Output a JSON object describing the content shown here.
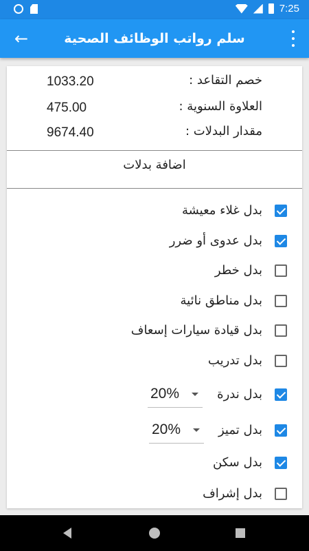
{
  "status_bar": {
    "time": "7:25"
  },
  "app_bar": {
    "title": "سلم رواتب الوظائف الصحية"
  },
  "summary": [
    {
      "label": "خصم التقاعد :",
      "value": "1033.20"
    },
    {
      "label": "العلاوة السنوية :",
      "value": "475.00"
    },
    {
      "label": "مقدار البدلات :",
      "value": "9674.40"
    }
  ],
  "allowances_section": {
    "title": "اضافة بدلات"
  },
  "allowances": [
    {
      "label": "بدل غلاء معيشة",
      "checked": true
    },
    {
      "label": "بدل عدوى أو ضرر",
      "checked": true
    },
    {
      "label": "بدل خطر",
      "checked": false
    },
    {
      "label": "بدل مناطق نائية",
      "checked": false
    },
    {
      "label": "بدل قيادة سيارات إسعاف",
      "checked": false
    },
    {
      "label": "بدل تدريب",
      "checked": false
    },
    {
      "label": "بدل ندرة",
      "checked": true,
      "dropdown": "20%"
    },
    {
      "label": "بدل تميز",
      "checked": true,
      "dropdown": "20%"
    },
    {
      "label": "بدل سكن",
      "checked": true
    },
    {
      "label": "بدل إشراف",
      "checked": false
    }
  ],
  "colors": {
    "status_bar": "#1e88e5",
    "app_bar": "#2196f3",
    "checkbox_checked": "#1e88e5"
  }
}
